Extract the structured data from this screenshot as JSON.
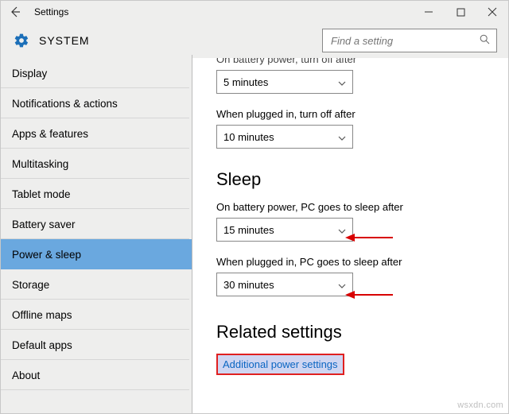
{
  "titlebar": {
    "app_title": "Settings"
  },
  "header": {
    "system_label": "SYSTEM",
    "search_placeholder": "Find a setting"
  },
  "sidebar": {
    "items": [
      {
        "label": "Display",
        "selected": false
      },
      {
        "label": "Notifications & actions",
        "selected": false
      },
      {
        "label": "Apps & features",
        "selected": false
      },
      {
        "label": "Multitasking",
        "selected": false
      },
      {
        "label": "Tablet mode",
        "selected": false
      },
      {
        "label": "Battery saver",
        "selected": false
      },
      {
        "label": "Power & sleep",
        "selected": true
      },
      {
        "label": "Storage",
        "selected": false
      },
      {
        "label": "Offline maps",
        "selected": false
      },
      {
        "label": "Default apps",
        "selected": false
      },
      {
        "label": "About",
        "selected": false
      }
    ]
  },
  "content": {
    "screen_off": {
      "battery_label_cut": "On battery power, turn off after",
      "battery_value": "5 minutes",
      "plugged_label": "When plugged in, turn off after",
      "plugged_value": "10 minutes"
    },
    "sleep": {
      "heading": "Sleep",
      "battery_label": "On battery power, PC goes to sleep after",
      "battery_value": "15 minutes",
      "plugged_label": "When plugged in, PC goes to sleep after",
      "plugged_value": "30 minutes"
    },
    "related": {
      "heading": "Related settings",
      "link": "Additional power settings"
    }
  },
  "watermark": "wsxdn.com"
}
